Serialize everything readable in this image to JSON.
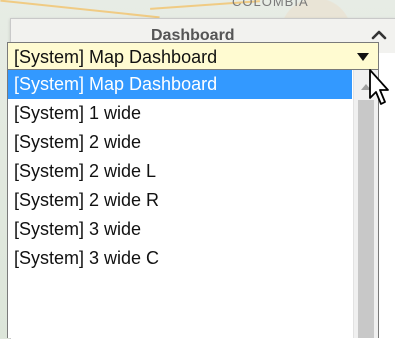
{
  "map": {
    "place_label": "COLOMBIA"
  },
  "panel": {
    "title": "Dashboard",
    "collapse_icon": "chevron-up-icon"
  },
  "select": {
    "current_value": "[System] Map Dashboard",
    "background_color": "#fffbd1",
    "arrow_icon": "triangle-down-icon"
  },
  "dropdown": {
    "highlight_color": "#3399ff",
    "options": [
      {
        "label": "[System] Map Dashboard",
        "selected": true
      },
      {
        "label": "[System] 1 wide"
      },
      {
        "label": "[System] 2 wide"
      },
      {
        "label": "[System] 2 wide L"
      },
      {
        "label": "[System] 2 wide R"
      },
      {
        "label": "[System] 3 wide"
      },
      {
        "label": "[System] 3 wide C"
      }
    ]
  },
  "cursor_icon": "mouse-pointer-icon"
}
